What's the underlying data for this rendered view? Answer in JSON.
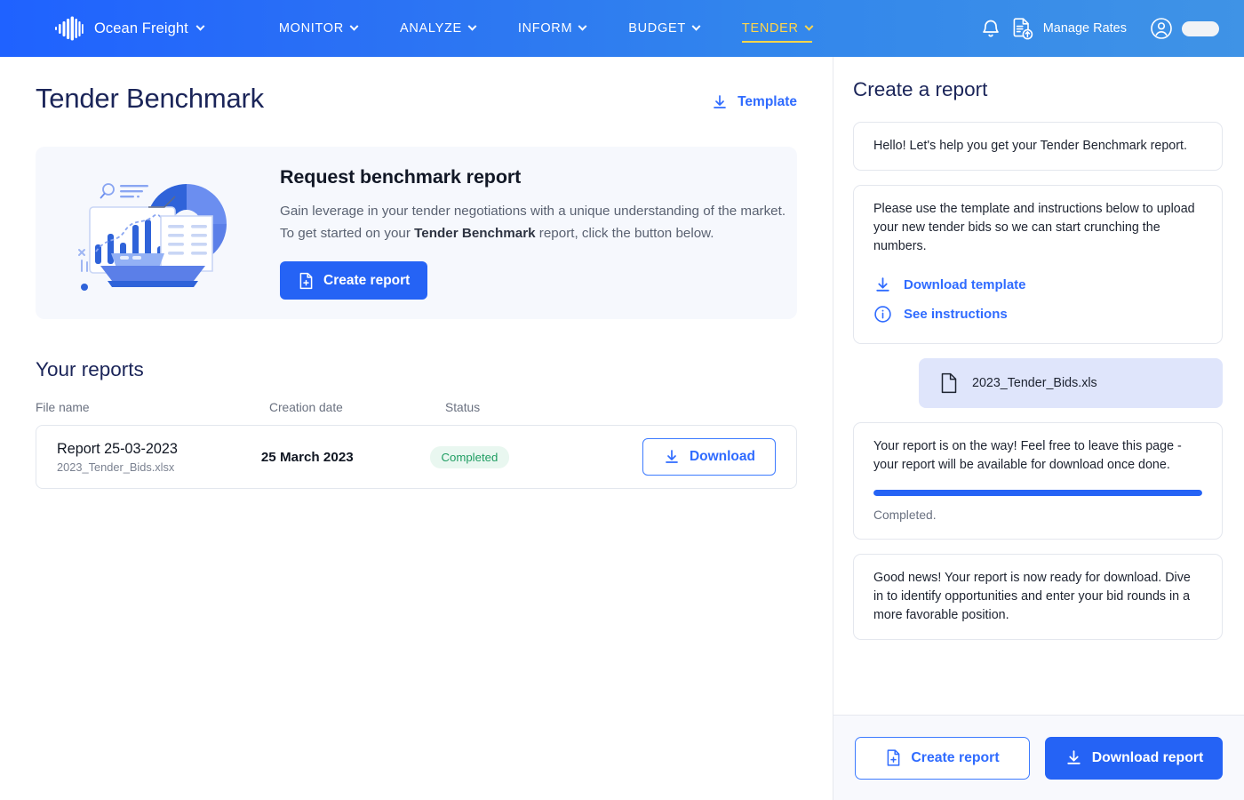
{
  "topnav": {
    "brand": {
      "name": "Ocean Freight",
      "logo_icon": "soundwave-bars-logo"
    },
    "items": [
      {
        "label": "MONITOR",
        "active": false
      },
      {
        "label": "ANALYZE",
        "active": false
      },
      {
        "label": "INFORM",
        "active": false
      },
      {
        "label": "BUDGET",
        "active": false
      },
      {
        "label": "TENDER",
        "active": true
      }
    ],
    "notifications_icon": "bell-icon",
    "manage_rates": {
      "label": "Manage Rates",
      "icon": "document-upload-icon"
    },
    "account_icon": "user-circle-icon",
    "accent_active": "#ffd64a"
  },
  "main": {
    "page_title": "Tender Benchmark",
    "template_link": "Template",
    "banner": {
      "title": "Request benchmark report",
      "line1": "Gain leverage in your tender negotiations with a unique understanding of the market.",
      "line2_pre": "To get started on your ",
      "line2_bold": "Tender Benchmark",
      "line2_post": " report, click the button below.",
      "cta_label": "Create report"
    },
    "reports": {
      "section_title": "Your reports",
      "columns": [
        "File name",
        "Creation date",
        "Status"
      ],
      "rows": [
        {
          "file_title": "Report 25-03-2023",
          "file_sub": "2023_Tender_Bids.xlsx",
          "date": "25 March 2023",
          "status": "Completed",
          "action_label": "Download"
        }
      ]
    }
  },
  "side": {
    "title": "Create a report",
    "messages": {
      "greeting": "Hello! Let's help you get your Tender Benchmark report.",
      "instructions": "Please use the template and instructions below to upload your new tender bids so we can start crunching the numbers.",
      "download_template": "Download template",
      "see_instructions": "See instructions",
      "uploaded_file": "2023_Tender_Bids.xls",
      "on_the_way": "Your report is on the way! Feel free to leave this page - your report will be available for download once done.",
      "progress_label": "Completed.",
      "progress_percent": 100,
      "ready": "Good news! Your report is now ready for download. Dive in to identify opportunities and enter your bid rounds in a more favorable position."
    },
    "footer": {
      "create_label": "Create report",
      "download_label": "Download report"
    }
  },
  "colors": {
    "brand_blue": "#2563f5",
    "link_blue": "#2f6bff",
    "status_green": "#1f9d62",
    "status_green_bg": "#e9f7f0",
    "active_yellow": "#ffd64a"
  }
}
